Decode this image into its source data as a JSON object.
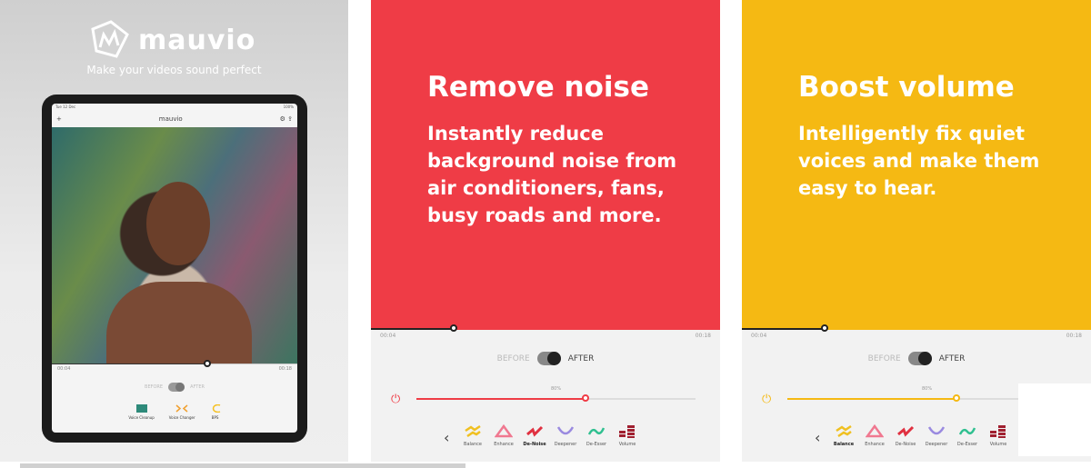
{
  "panel1": {
    "brand": "mauvio",
    "tagline": "Make your videos sound perfect",
    "tablet": {
      "status_time": "Tue 12 Dec",
      "battery": "100%",
      "nav_title": "mauvio",
      "time_start": "00:04",
      "time_end": "00:18",
      "before": "BEFORE",
      "after": "AFTER",
      "tools": [
        {
          "label": "Voice Cleanup",
          "color": "#2e8a7a"
        },
        {
          "label": "Voice Changer",
          "color": "#f0a030"
        },
        {
          "label": "BPS",
          "color": "#f5c020"
        }
      ]
    }
  },
  "panel2": {
    "accent": "#ef3c46",
    "heading": "Remove noise",
    "body": "Instantly reduce background noise from air conditioners, fans, busy roads and more.",
    "time_start": "00:04",
    "time_end": "00:18",
    "before": "BEFORE",
    "after": "AFTER",
    "level_label": "80%",
    "level": 0.61,
    "active_effect": "De-Noise"
  },
  "panel3": {
    "accent": "#f5b913",
    "heading": "Boost volume",
    "body": "Intelligently fix quiet voices and make them easy to hear.",
    "time_start": "00:04",
    "time_end": "00:18",
    "before": "BEFORE",
    "after": "AFTER",
    "level_label": "80%",
    "level": 0.61,
    "active_effect": "Balance"
  },
  "effects": [
    {
      "label": "Balance",
      "color": "#f0c020",
      "icon": "balance-icon"
    },
    {
      "label": "Enhance",
      "color": "#f07890",
      "icon": "enhance-icon"
    },
    {
      "label": "De-Noise",
      "color": "#e03040",
      "icon": "de-noise-icon"
    },
    {
      "label": "Deepener",
      "color": "#9a8ae0",
      "icon": "deepener-icon"
    },
    {
      "label": "De-Esser",
      "color": "#30c090",
      "icon": "de-esser-icon"
    },
    {
      "label": "Volume",
      "color": "#a02030",
      "icon": "volume-icon"
    }
  ]
}
